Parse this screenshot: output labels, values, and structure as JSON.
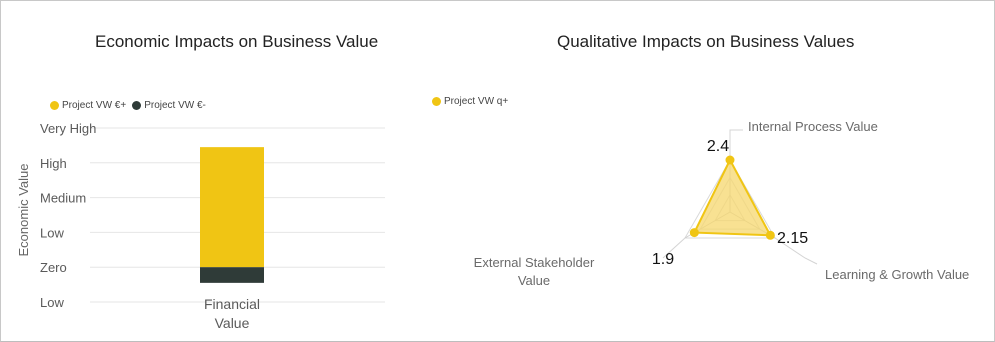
{
  "colors": {
    "positive": "#f0c514",
    "negative": "#2f3b38",
    "radar_fill": "#f5d76e",
    "grid": "#e6e6e6",
    "text": "#5a5a5a"
  },
  "chart_data": [
    {
      "type": "bar",
      "title": "Economic Impacts on Business Value",
      "ylabel": "Economic Value",
      "xlabel": "",
      "categories": [
        "Financial Value"
      ],
      "category_lines": [
        [
          "Financial",
          "Value"
        ]
      ],
      "y_tick_labels": [
        "Low",
        "Zero",
        "Low",
        "Medium",
        "High",
        "Very High"
      ],
      "series": [
        {
          "name": "Project VW €+",
          "values": [
            3.45
          ]
        },
        {
          "name": "Project VW €-",
          "values": [
            -0.45
          ]
        }
      ],
      "ylim": [
        -1,
        4
      ],
      "legend": "top-left",
      "grid": true
    },
    {
      "type": "radar",
      "title": "Qualitative Impacts on Business Values",
      "axes": [
        "Internal Process Value",
        "Learning & Growth Value",
        "External Stakeholder Value"
      ],
      "axis_label_lines": [
        [
          "Internal Process Value"
        ],
        [
          "Learning & Growth Value"
        ],
        [
          "External Stakeholder",
          "Value"
        ]
      ],
      "series": [
        {
          "name": "Project VW q+",
          "values": [
            2.4,
            2.15,
            1.9
          ],
          "labels": [
            "2.4",
            "2.15",
            "1.9"
          ]
        }
      ],
      "rmax": 2.4,
      "legend": "top-left",
      "grid": true
    }
  ]
}
